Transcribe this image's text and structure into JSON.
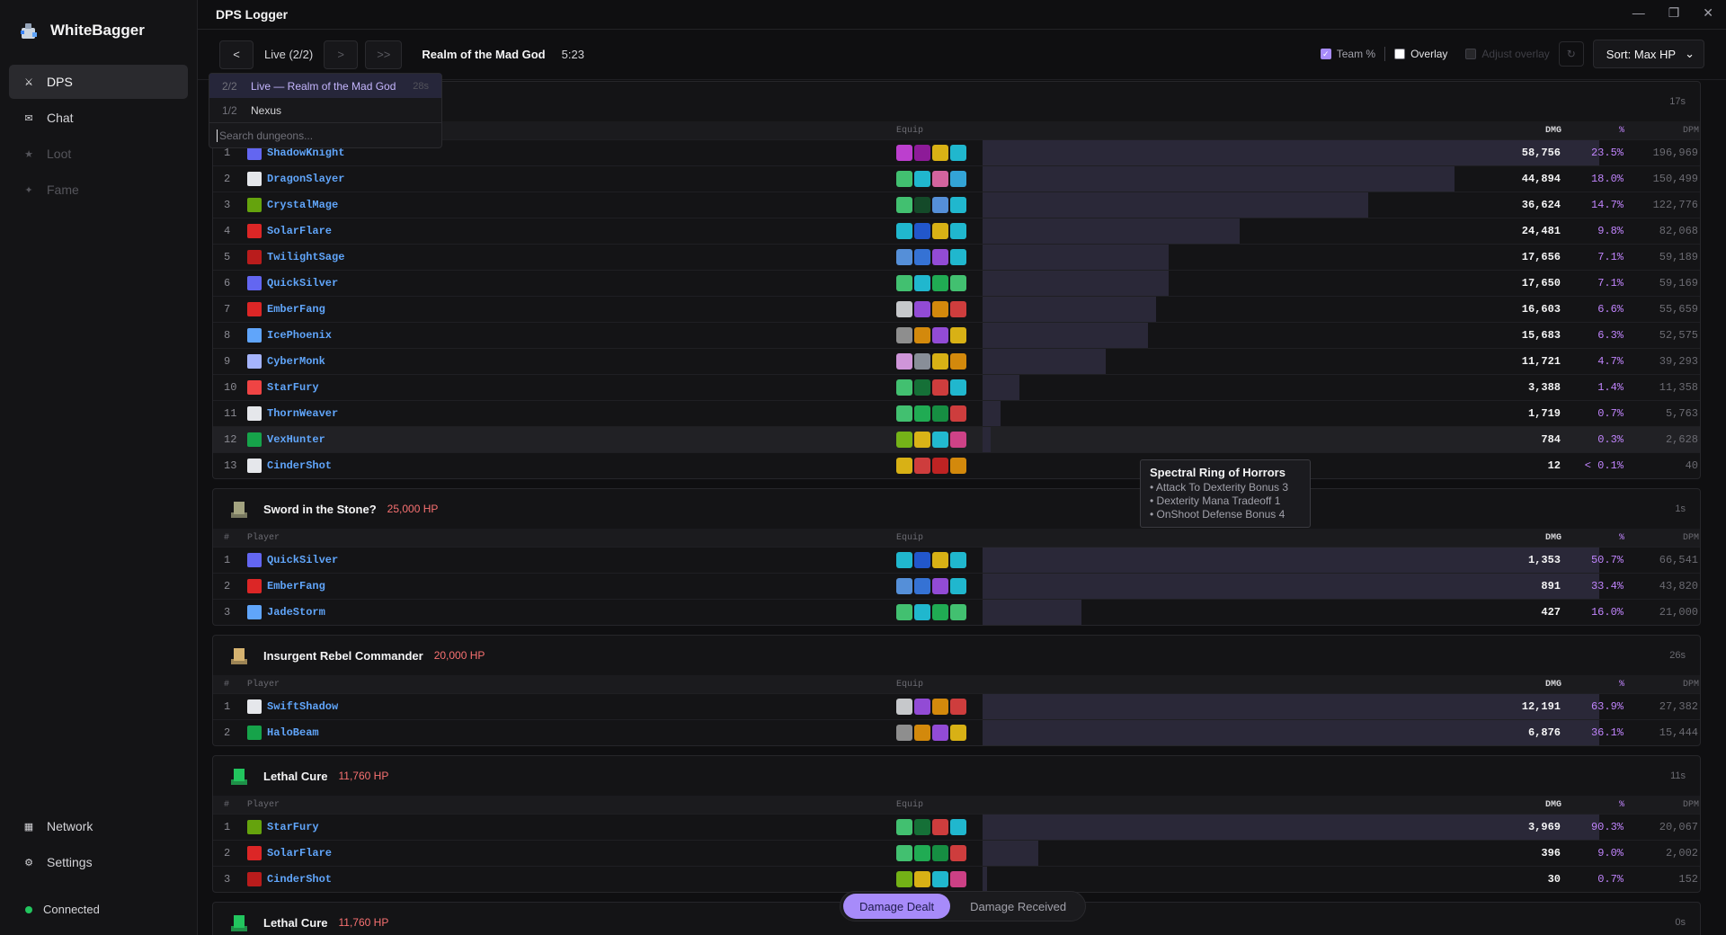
{
  "app": {
    "brand": "WhiteBagger",
    "window_title": "DPS Logger"
  },
  "sidebar": {
    "items": [
      {
        "label": "DPS",
        "icon": "swords-icon",
        "state": "active"
      },
      {
        "label": "Chat",
        "icon": "mail-icon",
        "state": "normal"
      },
      {
        "label": "Loot",
        "icon": "star-icon",
        "state": "disabled"
      },
      {
        "label": "Fame",
        "icon": "sparkle-icon",
        "state": "disabled"
      }
    ],
    "bottom_items": [
      {
        "label": "Network",
        "icon": "grid-icon"
      },
      {
        "label": "Settings",
        "icon": "gear-icon"
      }
    ],
    "status": "Connected"
  },
  "toolbar": {
    "prev": "<",
    "live": "Live (2/2)",
    "next": ">",
    "last": ">>",
    "dungeon": "Realm of the Mad God",
    "elapsed": "5:23",
    "team_pct": "Team %",
    "overlay": "Overlay",
    "adjust_overlay": "Adjust overlay",
    "sort": "Sort: Max HP"
  },
  "dropdown": {
    "items": [
      {
        "num": "2/2",
        "label": "Live — Realm of the Mad God",
        "age": "28s"
      },
      {
        "num": "1/2",
        "label": "Nexus",
        "age": ""
      }
    ],
    "search_placeholder": "Search dungeons..."
  },
  "columns": {
    "rank": "#",
    "player": "Player",
    "equip": "Equip",
    "dmg": "DMG",
    "pct": "%",
    "dpm": "DPM"
  },
  "panels": [
    {
      "boss": "",
      "hp": "",
      "age": "17s",
      "rows": [
        {
          "rank": "1",
          "name": "ShadowKnight",
          "dmg": "58,756",
          "pct": "23.5%",
          "dpm": "196,969",
          "share": 0.235
        },
        {
          "rank": "2",
          "name": "DragonSlayer",
          "dmg": "44,894",
          "pct": "18.0%",
          "dpm": "150,499",
          "share": 0.18
        },
        {
          "rank": "3",
          "name": "CrystalMage",
          "dmg": "36,624",
          "pct": "14.7%",
          "dpm": "122,776",
          "share": 0.147
        },
        {
          "rank": "4",
          "name": "SolarFlare",
          "dmg": "24,481",
          "pct": "9.8%",
          "dpm": "82,068",
          "share": 0.098
        },
        {
          "rank": "5",
          "name": "TwilightSage",
          "dmg": "17,656",
          "pct": "7.1%",
          "dpm": "59,189",
          "share": 0.071
        },
        {
          "rank": "6",
          "name": "QuickSilver",
          "dmg": "17,650",
          "pct": "7.1%",
          "dpm": "59,169",
          "share": 0.071
        },
        {
          "rank": "7",
          "name": "EmberFang",
          "dmg": "16,603",
          "pct": "6.6%",
          "dpm": "55,659",
          "share": 0.066
        },
        {
          "rank": "8",
          "name": "IcePhoenix",
          "dmg": "15,683",
          "pct": "6.3%",
          "dpm": "52,575",
          "share": 0.063
        },
        {
          "rank": "9",
          "name": "CyberMonk",
          "dmg": "11,721",
          "pct": "4.7%",
          "dpm": "39,293",
          "share": 0.047
        },
        {
          "rank": "10",
          "name": "StarFury",
          "dmg": "3,388",
          "pct": "1.4%",
          "dpm": "11,358",
          "share": 0.014
        },
        {
          "rank": "11",
          "name": "ThornWeaver",
          "dmg": "1,719",
          "pct": "0.7%",
          "dpm": "5,763",
          "share": 0.007
        },
        {
          "rank": "12",
          "name": "VexHunter",
          "dmg": "784",
          "pct": "0.3%",
          "dpm": "2,628",
          "share": 0.003
        },
        {
          "rank": "13",
          "name": "CinderShot",
          "dmg": "12",
          "pct": "< 0.1%",
          "dpm": "40",
          "share": 0.0
        }
      ]
    },
    {
      "boss": "Sword in the Stone?",
      "hp": "25,000 HP",
      "age": "1s",
      "rows": [
        {
          "rank": "1",
          "name": "QuickSilver",
          "dmg": "1,353",
          "pct": "50.7%",
          "dpm": "66,541",
          "share": 0.507
        },
        {
          "rank": "2",
          "name": "EmberFang",
          "dmg": "891",
          "pct": "33.4%",
          "dpm": "43,820",
          "share": 0.334
        },
        {
          "rank": "3",
          "name": "JadeStorm",
          "dmg": "427",
          "pct": "16.0%",
          "dpm": "21,000",
          "share": 0.16
        }
      ]
    },
    {
      "boss": "Insurgent Rebel Commander",
      "hp": "20,000 HP",
      "age": "26s",
      "rows": [
        {
          "rank": "1",
          "name": "SwiftShadow",
          "dmg": "12,191",
          "pct": "63.9%",
          "dpm": "27,382",
          "share": 0.639
        },
        {
          "rank": "2",
          "name": "HaloBeam",
          "dmg": "6,876",
          "pct": "36.1%",
          "dpm": "15,444",
          "share": 0.361
        }
      ]
    },
    {
      "boss": "Lethal Cure",
      "hp": "11,760 HP",
      "age": "11s",
      "rows": [
        {
          "rank": "1",
          "name": "StarFury",
          "dmg": "3,969",
          "pct": "90.3%",
          "dpm": "20,067",
          "share": 0.903
        },
        {
          "rank": "2",
          "name": "SolarFlare",
          "dmg": "396",
          "pct": "9.0%",
          "dpm": "2,002",
          "share": 0.09
        },
        {
          "rank": "3",
          "name": "CinderShot",
          "dmg": "30",
          "pct": "0.7%",
          "dpm": "152",
          "share": 0.007
        }
      ]
    },
    {
      "boss": "Lethal Cure",
      "hp": "11,760 HP",
      "age": "0s",
      "rows": []
    }
  ],
  "tooltip": {
    "title": "Spectral Ring of Horrors",
    "lines": [
      "Attack To Dexterity Bonus 3",
      "Dexterity Mana Tradeoff 1",
      "OnShoot Defense Bonus 4"
    ]
  },
  "bottom_toggle": {
    "dealt": "Damage Dealt",
    "received": "Damage Received"
  },
  "colors": {
    "accent": "#a78bfa",
    "player_name": "#60a5fa",
    "hp": "#f87171",
    "connected": "#22c55e"
  }
}
